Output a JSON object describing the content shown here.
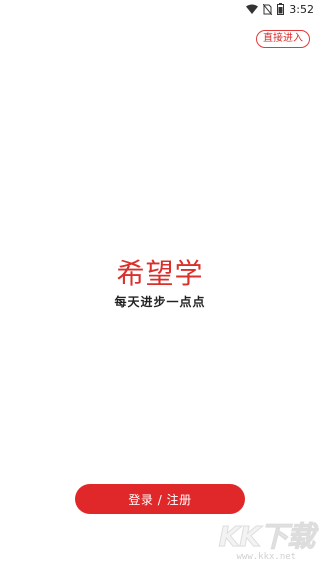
{
  "status_bar": {
    "time": "3:52",
    "icons": [
      "wifi-icon",
      "no-sim-icon",
      "battery-icon"
    ]
  },
  "skip_button": {
    "label": "直接进入"
  },
  "logo": {
    "title": "希望学",
    "slogan": "每天进步一点点",
    "color": "#d9302c"
  },
  "login_button": {
    "label": "登录 / 注册",
    "color": "#e0282a"
  },
  "watermark": {
    "mark": "KK下载",
    "url": "www.kkx.net"
  }
}
